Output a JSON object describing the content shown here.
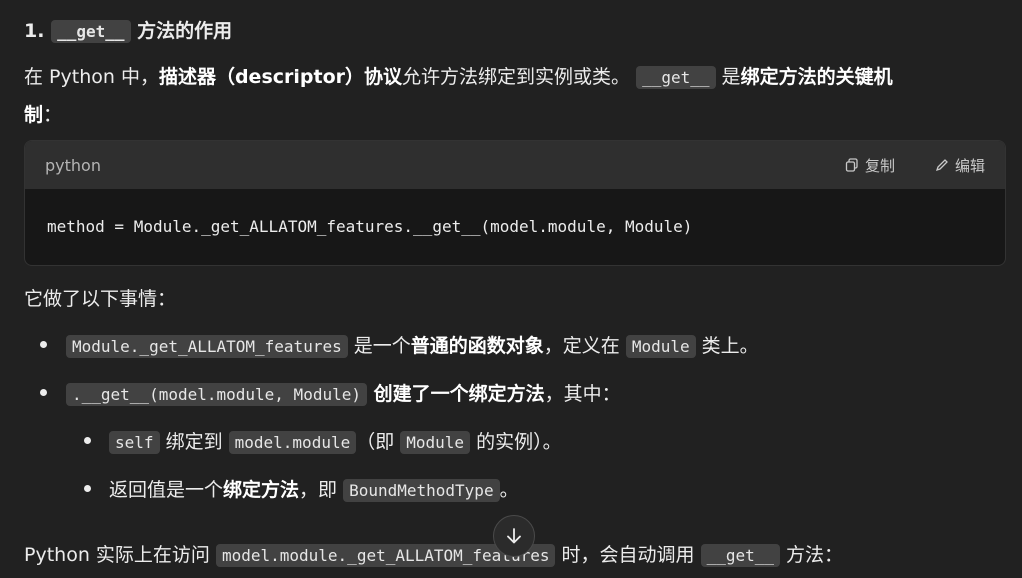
{
  "heading": {
    "num": "1.",
    "code": "__get__",
    "text": "方法的作用"
  },
  "intro": {
    "p1": "在 Python 中，",
    "b1": "描述器（descriptor）协议",
    "p2": "允许方法绑定到实例或类。",
    "code": "__get__",
    "p3": " 是",
    "b2": "绑定方法的关键机",
    "b3": "制",
    "p4": "："
  },
  "codeblock": {
    "lang": "python",
    "copy_label": "复制",
    "edit_label": "编辑",
    "code": "method = Module._get_ALLATOM_features.__get__(model.module, Module)"
  },
  "did": "它做了以下事情：",
  "bullets": {
    "b1": {
      "code": "Module._get_ALLATOM_features",
      "t1": " 是一个",
      "bold": "普通的函数对象",
      "t2": "，定义在 ",
      "code2": "Module",
      "t3": " 类上。"
    },
    "b2": {
      "code": ".__get__(model.module, Module)",
      "bold": " 创建了一个绑定方法",
      "t1": "，其中："
    },
    "s1": {
      "code": "self",
      "t1": " 绑定到 ",
      "code2": "model.module",
      "t2": "（即 ",
      "code3": "Module",
      "t3": " 的实例）。"
    },
    "s2": {
      "t1": "返回值是一个",
      "bold": "绑定方法",
      "t2": "，即 ",
      "code": "BoundMethodType",
      "t3": "。"
    }
  },
  "last": {
    "t1": "Python 实际上在访问 ",
    "code": "model.module._get_ALLATOM_features",
    "t2": " 时，会自动调用 ",
    "code2": "__get__",
    "t3": " 方法："
  }
}
